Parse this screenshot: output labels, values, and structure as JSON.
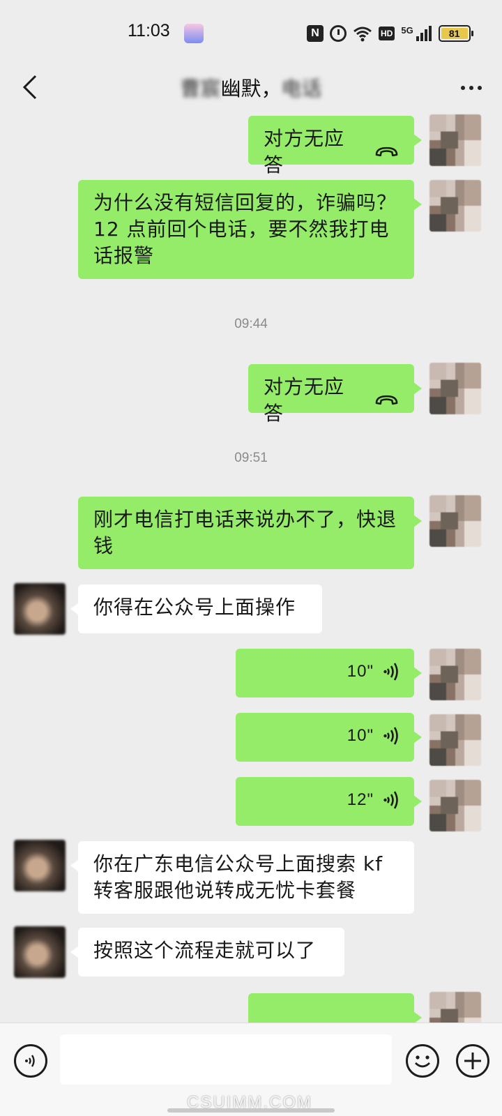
{
  "status_bar": {
    "time": "11:03",
    "icons": [
      "app-notification-icon",
      "nfc-icon",
      "alarm-icon",
      "wifi-icon",
      "hd-icon",
      "signal-5g-icon",
      "battery-icon"
    ],
    "hd_label": "HD",
    "network_label": "5G",
    "battery": "81"
  },
  "header": {
    "title_blur_left": "曹宸",
    "title_visible": "幽默，",
    "title_blur_right": "电话"
  },
  "messages": [
    {
      "type": "call",
      "from": "me",
      "text": "对方无应答"
    },
    {
      "type": "text",
      "from": "me",
      "text": "为什么没有短信回复的，诈骗吗？12 点前回个电话，要不然我打电话报警"
    },
    {
      "type": "time",
      "text": "09:44"
    },
    {
      "type": "call",
      "from": "me",
      "text": "对方无应答"
    },
    {
      "type": "time",
      "text": "09:51"
    },
    {
      "type": "text",
      "from": "me",
      "text": "刚才电信打电话来说办不了，快退钱"
    },
    {
      "type": "text",
      "from": "them",
      "text": "你得在公众号上面操作"
    },
    {
      "type": "voice",
      "from": "me",
      "duration": "10\""
    },
    {
      "type": "voice",
      "from": "me",
      "duration": "10\""
    },
    {
      "type": "voice",
      "from": "me",
      "duration": "12\""
    },
    {
      "type": "text",
      "from": "them",
      "text": "你在广东电信公众号上面搜索 kf 转客服跟他说转成无忧卡套餐"
    },
    {
      "type": "text",
      "from": "them",
      "text": "按照这个流程走就可以了"
    }
  ],
  "input_bar": {
    "placeholder": ""
  },
  "watermark": "CSUIMM.COM",
  "colors": {
    "background": "#ededed",
    "my_bubble": "#95ec69",
    "their_bubble": "#ffffff"
  }
}
